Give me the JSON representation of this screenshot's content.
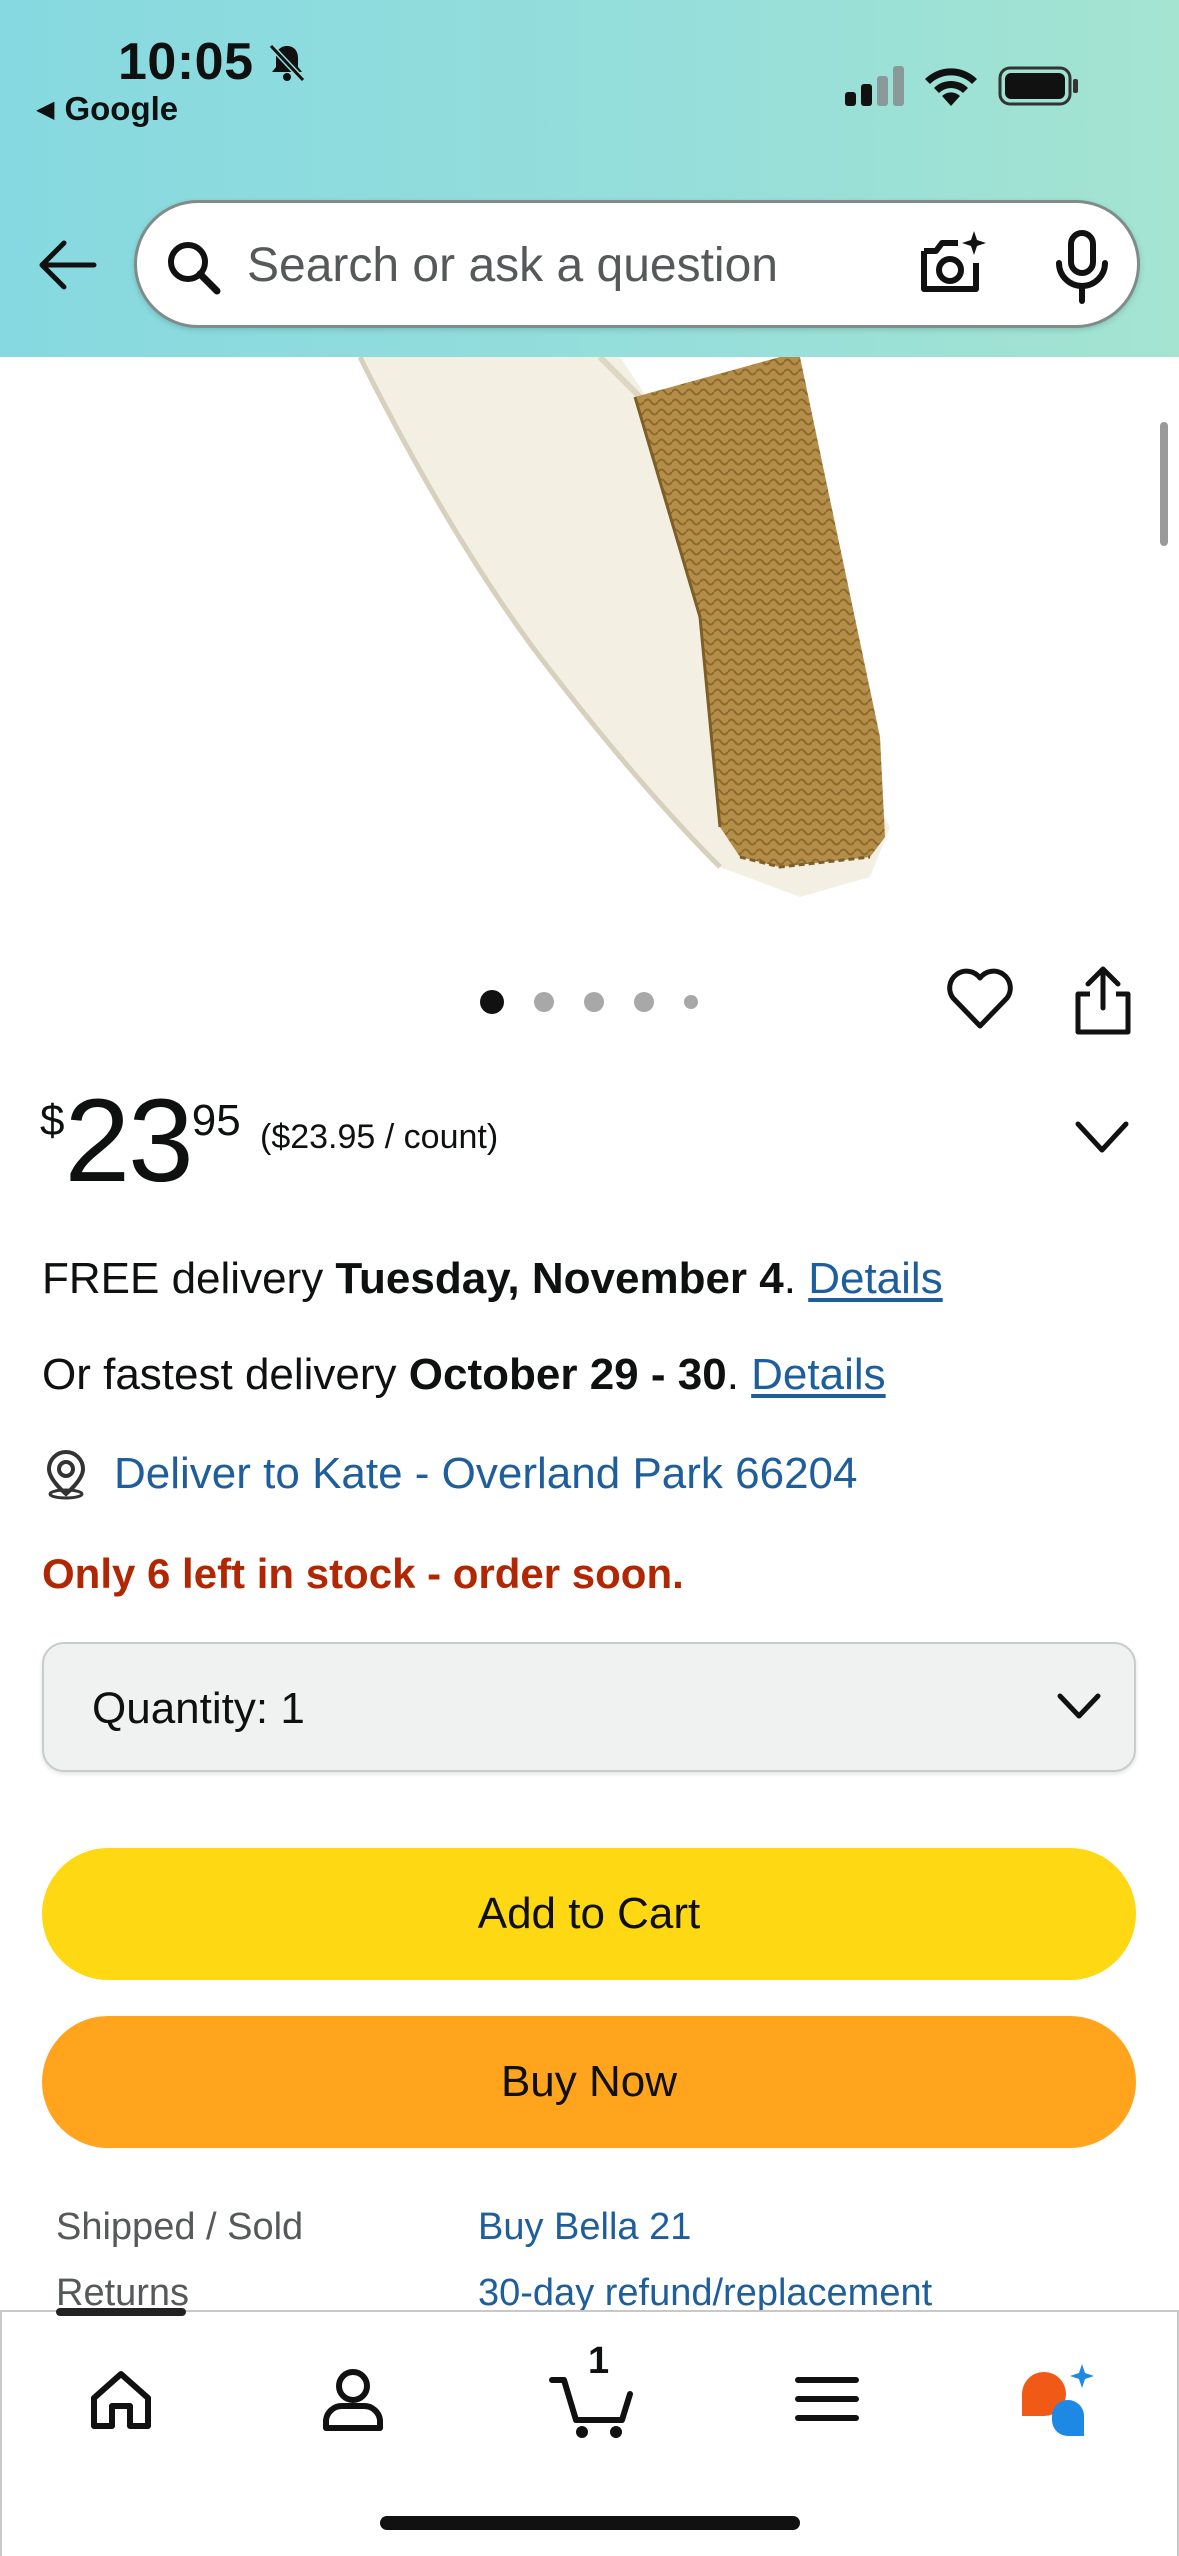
{
  "status_bar": {
    "time": "10:05",
    "back_app": "Google"
  },
  "search": {
    "placeholder": "Search or ask a question"
  },
  "carousel": {
    "image_count": 5,
    "active_index": 0
  },
  "price": {
    "currency": "$",
    "whole": "23",
    "fraction": "95",
    "unit_price": "($23.95 / count)"
  },
  "delivery": {
    "free_prefix": "FREE delivery ",
    "free_date": "Tuesday, November 4",
    "free_suffix": ". ",
    "free_link": "Details",
    "fast_prefix": "Or fastest delivery ",
    "fast_date": "October 29 - 30",
    "fast_suffix": ". ",
    "fast_link": "Details",
    "deliver_to": "Deliver to Kate - Overland Park 66204"
  },
  "stock": {
    "message": "Only 6 left in stock - order soon."
  },
  "quantity": {
    "label": "Quantity:",
    "value": "1"
  },
  "buttons": {
    "add_to_cart": "Add to Cart",
    "buy_now": "Buy Now"
  },
  "details": {
    "shipped_label": "Shipped / Sold",
    "shipped_value": "Buy Bella 21",
    "returns_label": "Returns",
    "returns_value": "30-day refund/replacement"
  },
  "bottom_nav": {
    "cart_count": "1",
    "items": [
      "home-icon",
      "account-icon",
      "cart-icon",
      "menu-icon",
      "rufus-icon"
    ]
  },
  "colors": {
    "header_gradient_start": "#86d9e0",
    "header_gradient_end": "#a4e4d1",
    "add_to_cart": "#ffd814",
    "buy_now": "#ffa41c",
    "link": "#1f5e9c",
    "stock_warning": "#b12704"
  }
}
